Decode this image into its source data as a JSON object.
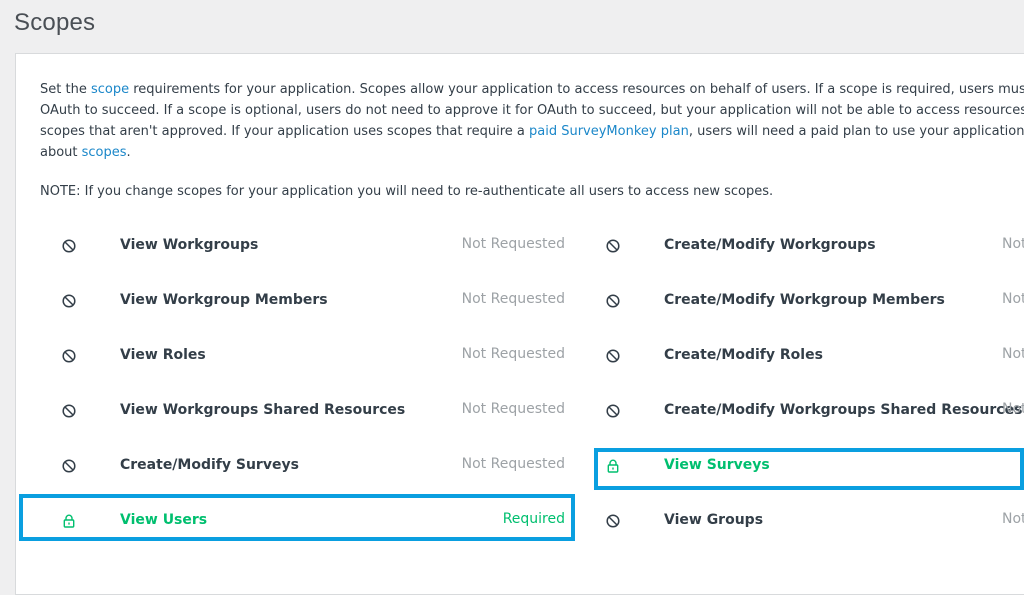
{
  "page_title": "Scopes",
  "description": {
    "p1_a": "Set the ",
    "link_scope": "scope",
    "p1_b": " requirements for your application. Scopes allow your application to access resources on behalf of users. If a scope is required, users mus",
    "p2": "OAuth to succeed. If a scope is optional, users do not need to approve it for OAuth to succeed, but your application will not be able to access resources",
    "p3_a": "scopes that aren't approved. If your application uses scopes that require a ",
    "link_plan": "paid SurveyMonkey plan",
    "p3_b": ", users will need a paid plan to use your application",
    "p4_a": "about ",
    "link_scopes": "scopes",
    "p4_b": "."
  },
  "note": "NOTE: If you change scopes for your application you will need to re-authenticate all users to access new scopes.",
  "left_scopes": [
    {
      "name": "View Workgroups",
      "status": "Not Requested",
      "icon": "block-icon"
    },
    {
      "name": "View Workgroup Members",
      "status": "Not Requested",
      "icon": "block-icon"
    },
    {
      "name": "View Roles",
      "status": "Not Requested",
      "icon": "block-icon"
    },
    {
      "name": "View Workgroups Shared Resources",
      "status": "Not Requested",
      "icon": "block-icon"
    },
    {
      "name": "Create/Modify Surveys",
      "status": "Not Requested",
      "icon": "block-icon"
    },
    {
      "name": "View Users",
      "status": "Required",
      "icon": "lock-icon"
    }
  ],
  "right_scopes": [
    {
      "name": "Create/Modify Workgroups",
      "status": "Not",
      "icon": "block-icon"
    },
    {
      "name": "Create/Modify Workgroup Members",
      "status": "Not",
      "icon": "block-icon"
    },
    {
      "name": "Create/Modify Roles",
      "status": "Not",
      "icon": "block-icon"
    },
    {
      "name": "Create/Modify Workgroups Shared Resources",
      "status": "Not",
      "icon": "block-icon"
    },
    {
      "name": "View Surveys",
      "status": "",
      "icon": "lock-icon"
    },
    {
      "name": "View Groups",
      "status": "Not",
      "icon": "block-icon"
    }
  ],
  "colors": {
    "required_green": "#00bf6f",
    "link_blue": "#1b87c9",
    "highlight_blue": "#0a9fe0",
    "muted_gray": "#9da2a6"
  }
}
